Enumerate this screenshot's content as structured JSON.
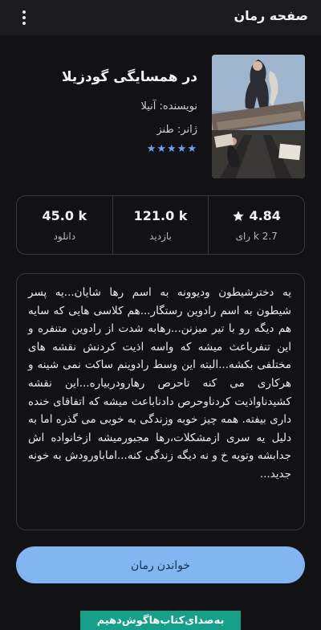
{
  "appbar": {
    "title": "صفحه رمان",
    "menu_icon": "more-vert-icon"
  },
  "book": {
    "title": "در همسایگی گودزیلا",
    "author": "نویسنده: آنیلا",
    "genre": "ژانر: طنز",
    "rating_stars": "★★★★★",
    "cover_colors": {
      "sky": "#8aa3c0",
      "frame": "#6d6157",
      "ground": "#3a3834"
    }
  },
  "stats": [
    {
      "value": "45.0 k",
      "label": "دانلود"
    },
    {
      "value": "121.0 k",
      "label": "بازدید"
    },
    {
      "value": "4.84",
      "label": "2.7 k رای",
      "icon": "star-icon"
    }
  ],
  "description": "یه دخترشیطون ودیوونه به اسم رها شایان...یه پسر شیطون به اسم رادوین رستگار...هم کلاسی هایی که سایه هم دیگه رو با تیر میزنن...رهابه شدت از رادوین متنفره و این تنفرباعث میشه که واسه اذیت کردنش نقشه های مختلفی بکشه...البته این وسط رادوینم ساکت نمی شینه و هرکاری می کنه تاحرص رهارودربیاره...این نقشه کشیدناواذیت کردناوحرص دادناباعث میشه که اتفاقای خنده داری بیفته. همه چیز خوبه وزندگی به خوبی می گذره اما به دلیل یه سری ازمشکلات،رها مجبورمیشه ازخانواده اش جدابشه وتویه خ و نه دیگه زندگی کنه...اماباورودش به خونه جدید...",
  "read_button": "خواندن رمان",
  "banner": "به‌صدای‌کتاب‌هاگوش‌دهیم",
  "colors": {
    "accent": "#82b6f1",
    "star": "#64a6f2",
    "background": "#121214",
    "banner": "#14a089"
  }
}
